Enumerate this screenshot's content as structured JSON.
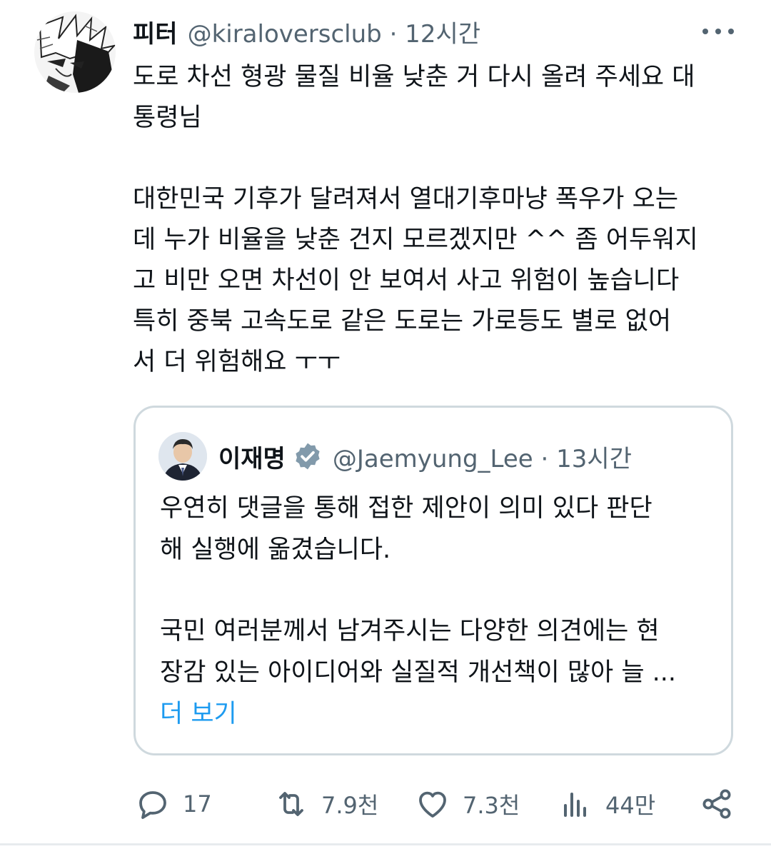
{
  "tweet": {
    "author_name": "피터",
    "meta": "@kiraloversclub · 12시간",
    "body_lines": [
      "도로 차선 형광 물질 비율 낮춘 거 다시 올려 주세요 대",
      "통령님",
      "",
      "대한민국 기후가 달려져서 열대기후마냥 폭우가 오는",
      "데 누가 비율을 낮춘 건지 모르겠지만 ^^ 좀 어두워지",
      "고 비만 오면 차선이 안 보여서 사고 위험이 높습니다",
      "특히 중북 고속도로 같은 도로는 가로등도 별로 없어",
      "서 더 위험해요 ㅜㅜ"
    ]
  },
  "quoted": {
    "author_name": "이재명",
    "meta": "@Jaemyung_Lee · 13시간",
    "body_lines": [
      "우연히 댓글을 통해 접한 제안이 의미 있다 판단",
      "해 실행에 옮겼습니다.",
      "",
      "국민 여러분께서 남겨주시는 다양한 의견에는 현",
      "장감 있는 아이디어와 실질적 개선책이 많아 늘 ..."
    ],
    "show_more": "더 보기"
  },
  "actions": {
    "replies": "17",
    "retweets": "7.9천",
    "likes": "7.3천",
    "views": "44만"
  },
  "icons": {
    "reply": "reply-icon",
    "retweet": "retweet-icon",
    "like": "heart-icon",
    "views": "bar-chart-icon",
    "share": "share-icon",
    "more": "more-horizontal-icon",
    "verified": "verified-badge-icon"
  },
  "colors": {
    "text": "#0f1419",
    "secondary": "#536471",
    "link": "#1d9bf0",
    "border": "#cfd9de",
    "verified": "#829aab"
  }
}
